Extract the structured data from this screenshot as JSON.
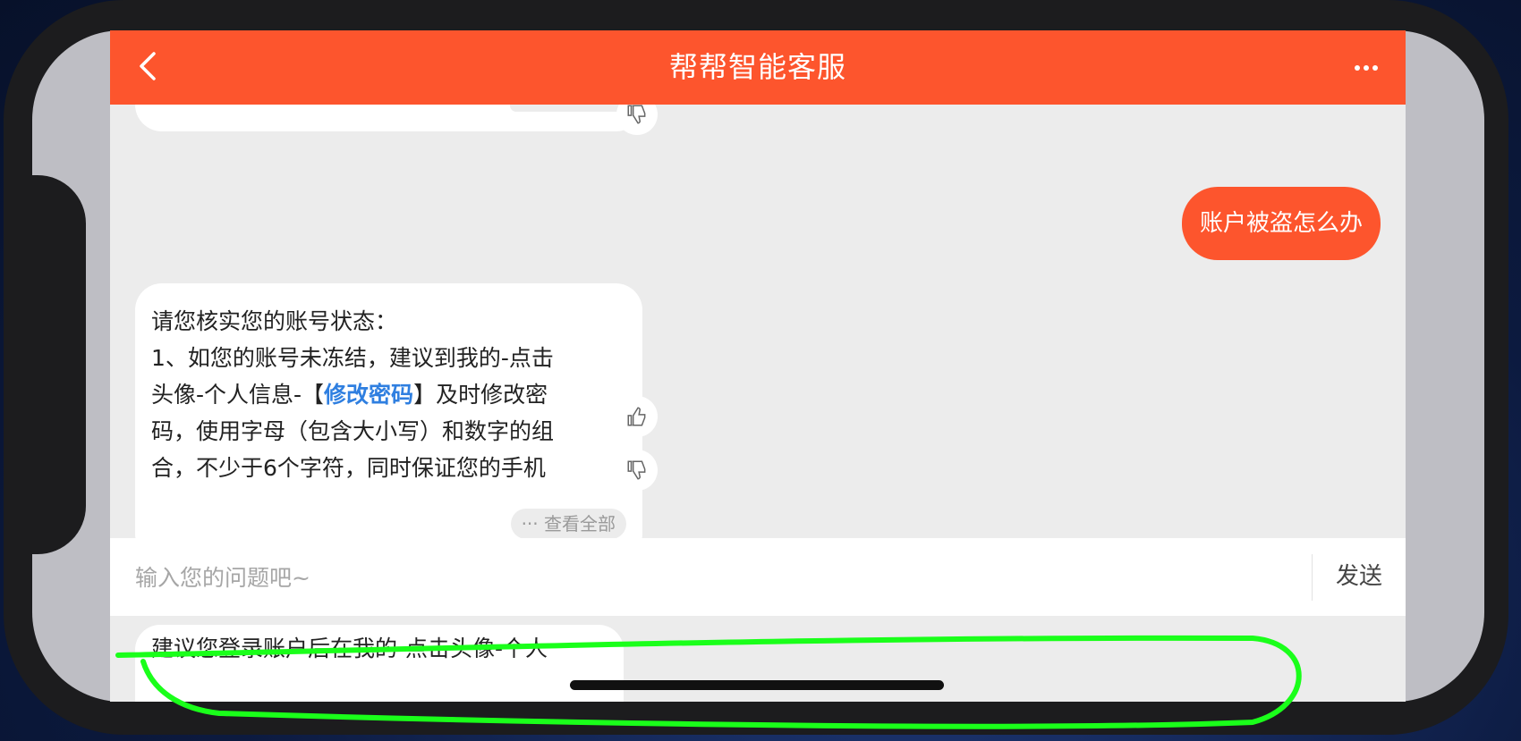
{
  "header": {
    "title": "帮帮智能客服",
    "back_icon": "chevron-left-icon",
    "more_icon": "more-dots-icon",
    "bg_color": "#fd552d"
  },
  "messages": {
    "user_question": "账户被盗怎么办",
    "bot_reply_lines": [
      "请您核实您的账号状态：",
      "1、如您的账号未冻结，建议到我的-点击",
      "头像-个人信息-【",
      "修改密码",
      "】及时修改密",
      "码，使用字母（包含大小写）和数字的组",
      "合，不少于6个字符，同时保证您的手机"
    ],
    "view_all_label": "··· 查看全部",
    "thumb_up_icon": "thumb-up-icon",
    "thumb_down_icon": "thumb-down-icon"
  },
  "input": {
    "placeholder": "输入您的问题吧~",
    "send_label": "发送"
  },
  "suggestion": {
    "text": "建议您登录账户后在我的-点击头像-个人"
  },
  "colors": {
    "accent": "#fd552d",
    "link": "#2f7fe0",
    "annotation": "#1aff1a"
  }
}
